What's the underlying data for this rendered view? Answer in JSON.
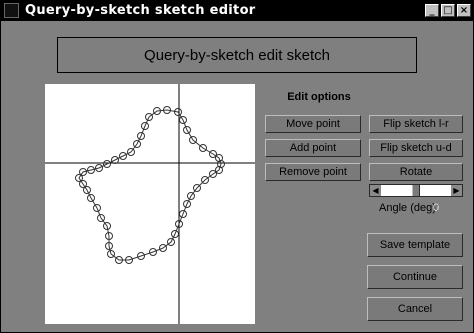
{
  "window": {
    "title": "Query-by-sketch sketch editor",
    "controls": [
      "_",
      "□",
      "×"
    ]
  },
  "header": {
    "title": "Query-by-sketch edit sketch"
  },
  "edit_options": {
    "label": "Edit options",
    "move_point": "Move point",
    "add_point": "Add point",
    "remove_point": "Remove point",
    "flip_lr": "Flip sketch l-r",
    "flip_ud": "Flip sketch u-d",
    "rotate": "Rotate"
  },
  "angle": {
    "label": "Angle (deg):",
    "value": "0",
    "slider_value": 0.5
  },
  "actions": {
    "save_template": "Save template",
    "continue": "Continue",
    "cancel": "Cancel"
  },
  "colors": {
    "background": "#808080",
    "titlebar": "#000000",
    "canvas": "#ffffff"
  },
  "icons": {
    "window_icon": "matlab-figure-icon"
  }
}
